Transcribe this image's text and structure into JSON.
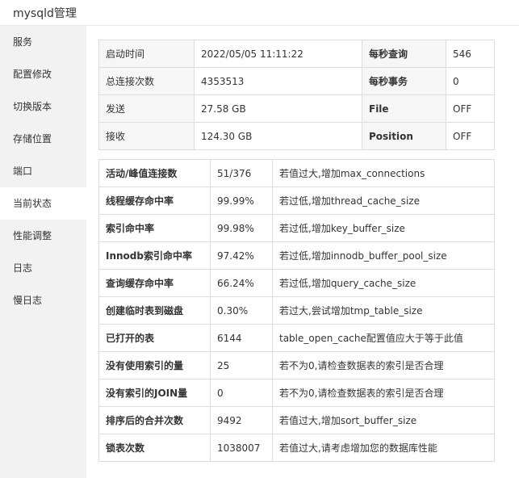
{
  "window": {
    "title": "mysqld管理"
  },
  "sidebar": {
    "items": [
      {
        "label": "服务"
      },
      {
        "label": "配置修改"
      },
      {
        "label": "切换版本"
      },
      {
        "label": "存储位置"
      },
      {
        "label": "端口"
      },
      {
        "label": "当前状态"
      },
      {
        "label": "性能调整"
      },
      {
        "label": "日志"
      },
      {
        "label": "慢日志"
      }
    ],
    "active_index": 5
  },
  "summary": {
    "rows": [
      {
        "label1": "启动时间",
        "value1": "2022/05/05 11:11:22",
        "label2": "每秒查询",
        "value2": "546"
      },
      {
        "label1": "总连接次数",
        "value1": "4353513",
        "label2": "每秒事务",
        "value2": "0"
      },
      {
        "label1": "发送",
        "value1": "27.58 GB",
        "label2": "File",
        "value2": "OFF"
      },
      {
        "label1": "接收",
        "value1": "124.30 GB",
        "label2": "Position",
        "value2": "OFF"
      }
    ]
  },
  "metrics": {
    "rows": [
      {
        "name": "活动/峰值连接数",
        "value": "51/376",
        "advice": "若值过大,增加max_connections"
      },
      {
        "name": "线程缓存命中率",
        "value": "99.99%",
        "advice": "若过低,增加thread_cache_size"
      },
      {
        "name": "索引命中率",
        "value": "99.98%",
        "advice": "若过低,增加key_buffer_size"
      },
      {
        "name": "Innodb索引命中率",
        "value": "97.42%",
        "advice": "若过低,增加innodb_buffer_pool_size"
      },
      {
        "name": "查询缓存命中率",
        "value": "66.24%",
        "advice": "若过低,增加query_cache_size"
      },
      {
        "name": "创建临时表到磁盘",
        "value": "0.30%",
        "advice": "若过大,尝试增加tmp_table_size"
      },
      {
        "name": "已打开的表",
        "value": "6144",
        "advice": "table_open_cache配置值应大于等于此值"
      },
      {
        "name": "没有使用索引的量",
        "value": "25",
        "advice": "若不为0,请检查数据表的索引是否合理"
      },
      {
        "name": "没有索引的JOIN量",
        "value": "0",
        "advice": "若不为0,请检查数据表的索引是否合理"
      },
      {
        "name": "排序后的合并次数",
        "value": "9492",
        "advice": "若值过大,增加sort_buffer_size"
      },
      {
        "name": "锁表次数",
        "value": "1038007",
        "advice": "若值过大,请考虑增加您的数据库性能"
      }
    ]
  }
}
